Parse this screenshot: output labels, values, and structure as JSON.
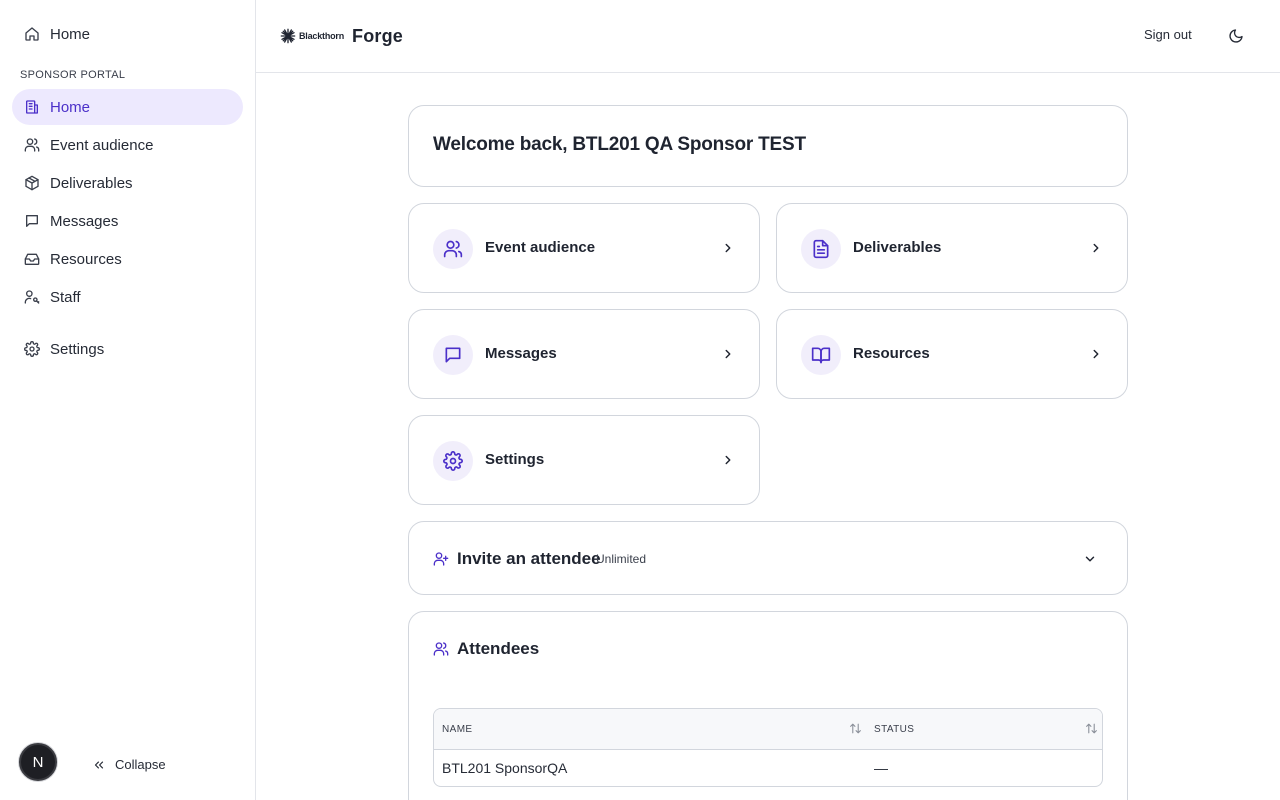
{
  "sidebar": {
    "top_home": "Home",
    "section_label": "SPONSOR PORTAL",
    "items": [
      {
        "label": "Home",
        "icon": "building-icon",
        "active": true
      },
      {
        "label": "Event audience",
        "icon": "users-icon"
      },
      {
        "label": "Deliverables",
        "icon": "package-icon"
      },
      {
        "label": "Messages",
        "icon": "message-icon"
      },
      {
        "label": "Resources",
        "icon": "inbox-icon"
      },
      {
        "label": "Staff",
        "icon": "user-key-icon"
      }
    ],
    "settings": "Settings",
    "avatar_letter": "N",
    "collapse": "Collapse"
  },
  "header": {
    "brand_text": "Blackthorn",
    "product": "Forge",
    "sign_out": "Sign out"
  },
  "main": {
    "welcome": "Welcome back, BTL201 QA Sponsor TEST",
    "tiles": [
      {
        "label": "Event audience",
        "icon": "users-icon"
      },
      {
        "label": "Deliverables",
        "icon": "document-icon"
      },
      {
        "label": "Messages",
        "icon": "message-icon"
      },
      {
        "label": "Resources",
        "icon": "book-open-icon"
      },
      {
        "label": "Settings",
        "icon": "gear-icon"
      }
    ],
    "invite": {
      "title": "Invite an attendee",
      "badge": "Unlimited"
    },
    "attendees": {
      "title": "Attendees",
      "columns": [
        "NAME",
        "STATUS"
      ],
      "rows": [
        {
          "name": "BTL201 SponsorQA",
          "status": "—"
        }
      ]
    }
  },
  "colors": {
    "accent": "#4b30c9",
    "active_bg": "#ede9fe",
    "tile_icon_bg": "#f1eefb"
  }
}
